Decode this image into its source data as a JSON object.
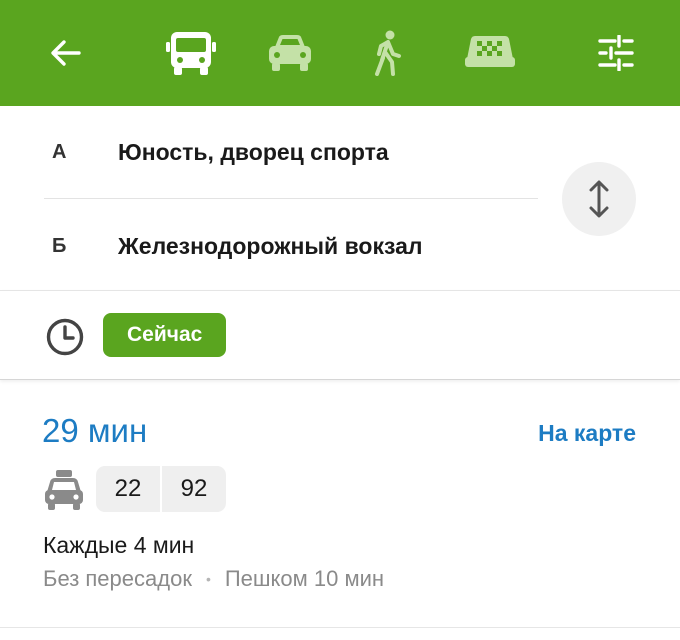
{
  "toolbar": {
    "icons": {
      "back": "arrow-left-icon",
      "bus": "bus-icon",
      "car": "car-icon",
      "walk": "pedestrian-icon",
      "taxi": "taxi-icon",
      "settings": "sliders-icon"
    },
    "active_mode": "bus"
  },
  "route_points": {
    "from": {
      "letter": "А",
      "name": "Юность, дворец спорта"
    },
    "to": {
      "letter": "Б",
      "name": "Железнодорожный вокзал"
    }
  },
  "time": {
    "chip_label": "Сейчас"
  },
  "route": {
    "duration": "29 мин",
    "map_link": "На карте",
    "transport_icon": "route-taxi-icon",
    "numbers": [
      "22",
      "92"
    ],
    "interval": "Каждые 4 мин",
    "transfers": "Без пересадок",
    "separator": "•",
    "walk": "Пешком 10 мин"
  },
  "colors": {
    "brand_green": "#5aa51f",
    "link_blue": "#1d7cc3",
    "muted_text": "#8a8a8a"
  }
}
